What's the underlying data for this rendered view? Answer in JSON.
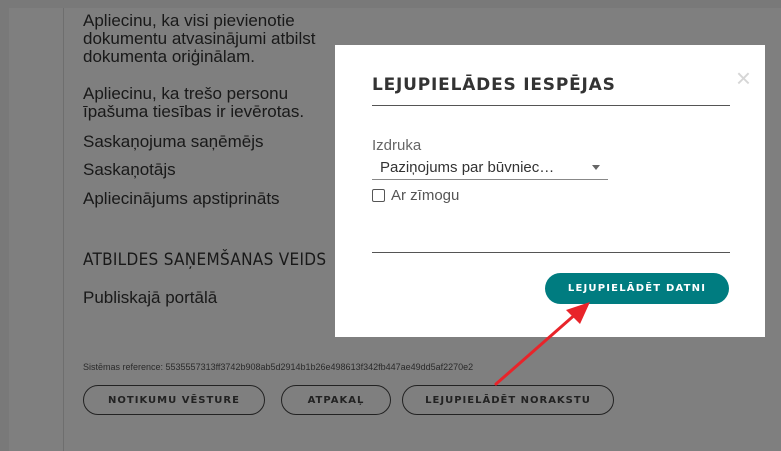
{
  "background": {
    "lines": [
      "Apliecinu, ka visi pievienotie",
      "dokumentu atvasinājumi atbilst",
      "dokumenta oriģinālam.",
      "Apliecinu, ka trešo personu",
      "īpašuma tiesības ir ievērotas.",
      "Saskaņojuma saņēmējs",
      "Saskaņotājs",
      "Apliecinājums apstiprināts"
    ],
    "response_heading": "ATBILDES SAŅEMŠANAS VEIDS",
    "response_value": "Publiskajā portālā",
    "system_reference": "Sistēmas reference: 5535557313ff3742b908ab5d2914b1b26e498613f342fb447ae49dd5af2270e2",
    "buttons": {
      "history": "NOTIKUMU VĒSTURE",
      "back": "ATPAKAĻ",
      "download_record": "LEJUPIELĀDĒT NORAKSTU"
    }
  },
  "modal": {
    "title": "LEJUPIELĀDES IESPĒJAS",
    "close_symbol": "×",
    "print_label": "Izdruka",
    "print_select_value": "Paziņojums par būvniec…",
    "stamp_checkbox_label": "Ar zīmogu",
    "stamp_checked": false,
    "download_button": "LEJUPIELĀDĒT DATNI"
  },
  "colors": {
    "accent": "#007c80",
    "annotation_arrow": "#e8242a"
  },
  "icons": {
    "close": "close-icon",
    "dropdown": "chevron-down-icon"
  }
}
